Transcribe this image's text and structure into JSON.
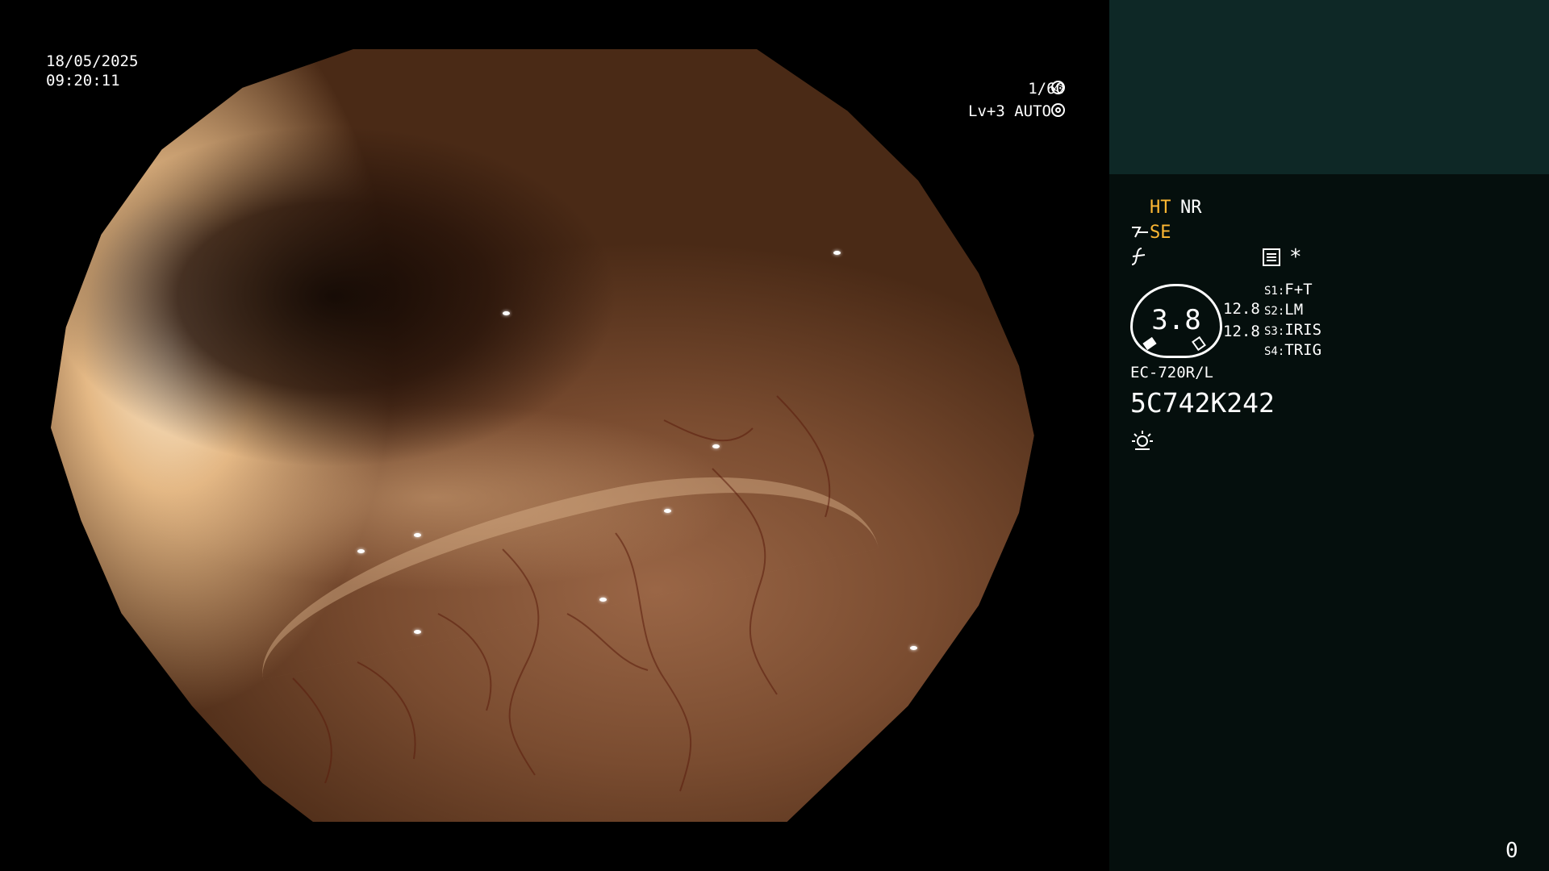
{
  "overlay": {
    "date": "18/05/2025",
    "time": "09:20:11",
    "shutter": "1/60",
    "shutter_icon": "aperture-icon",
    "level": "Lv+3 AUTO",
    "level_icon": "target-icon"
  },
  "panel": {
    "colors": {
      "accent": "#ffb833",
      "top_band": "#0e2826",
      "background": "#050f0d"
    },
    "modes_row1": {
      "ht": "HT",
      "nr": "NR"
    },
    "modes_row2": {
      "icon": "enhance-icon",
      "se": "SE"
    },
    "modes_row3": {
      "icon": "gamma-icon",
      "menu_icon": "menu-list-icon",
      "star": "*"
    },
    "meter": {
      "value": "3.8",
      "left_value_1": "12.8",
      "left_value_2": "12.8"
    },
    "switches": [
      {
        "key": "S1:",
        "value": "F+T"
      },
      {
        "key": "S2:",
        "value": "LM"
      },
      {
        "key": "S3:",
        "value": "IRIS"
      },
      {
        "key": "S4:",
        "value": "TRIG"
      }
    ],
    "scope_model": "EC-720R/L",
    "scope_serial": "5C742K242",
    "light_icon": "light-source-icon"
  },
  "footer": {
    "frame_counter": "0"
  }
}
